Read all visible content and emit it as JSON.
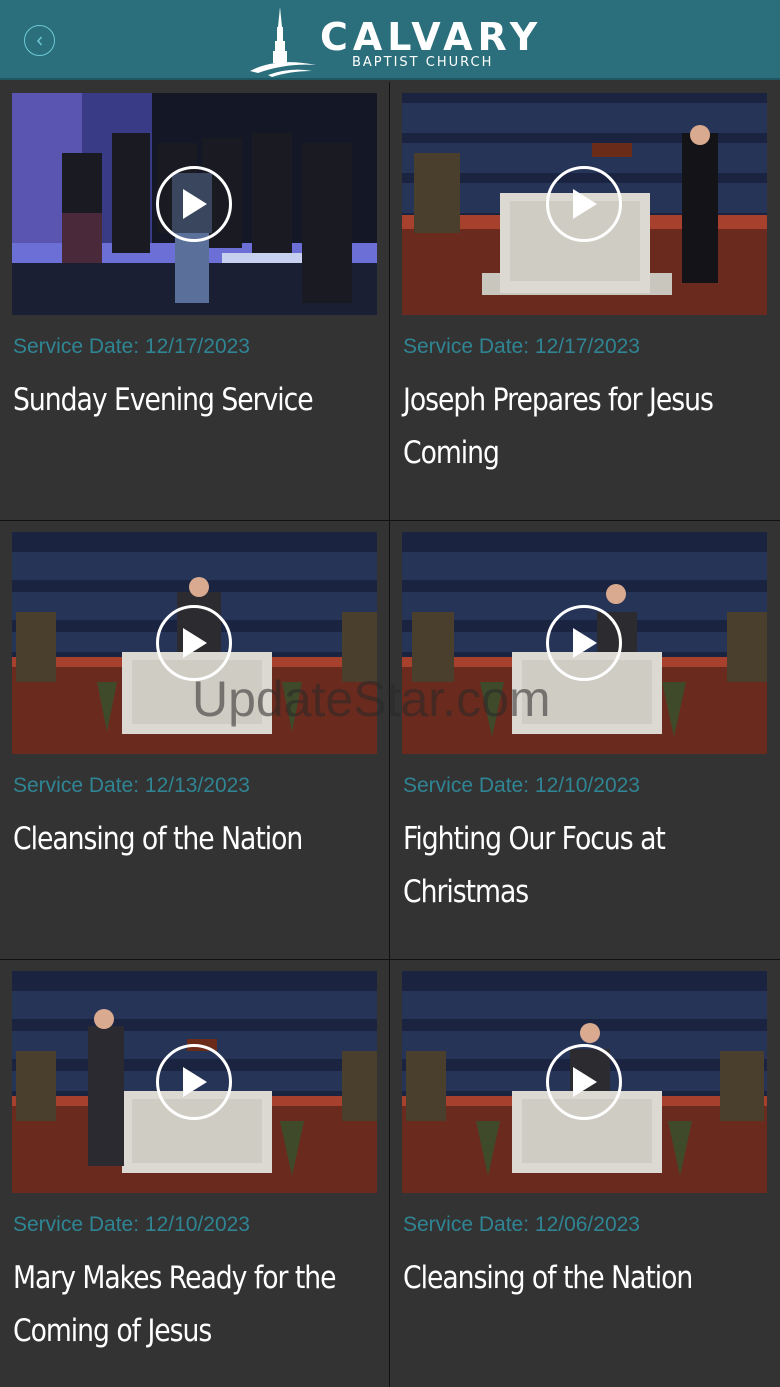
{
  "header": {
    "logo_word": "CALVARY",
    "logo_sub": "BAPTIST CHURCH",
    "back_icon": "chevron-left-icon",
    "bg_color": "#2b6f7d"
  },
  "videos": [
    {
      "date": "Service Date: 12/17/2023",
      "title": "Sunday Evening Service"
    },
    {
      "date": "Service Date: 12/17/2023",
      "title": "Joseph Prepares for Jesus Coming"
    },
    {
      "date": "Service Date: 12/13/2023",
      "title": "Cleansing of the Nation"
    },
    {
      "date": "Service Date: 12/10/2023",
      "title": "Fighting Our Focus at Christmas"
    },
    {
      "date": "Service Date: 12/10/2023",
      "title": "Mary Makes Ready for the Coming of Jesus"
    },
    {
      "date": "Service Date: 12/06/2023",
      "title": "Cleansing of the Nation"
    }
  ],
  "watermark": "UpdateStar.com",
  "accent_color": "#2f8594"
}
